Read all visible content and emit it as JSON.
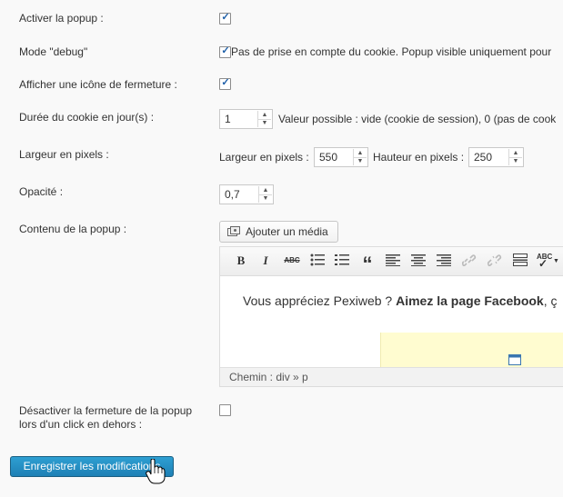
{
  "settings": {
    "activer_popup": {
      "label": "Activer la popup :",
      "checked": true
    },
    "mode_debug": {
      "label": "Mode \"debug\"",
      "checked": true,
      "description": "Pas de prise en compte du cookie. Popup visible uniquement pour"
    },
    "icone_fermeture": {
      "label": "Afficher une icône de fermeture :",
      "checked": true
    },
    "duree_cookie": {
      "label": "Durée du cookie en jour(s) :",
      "value": "1",
      "description": "Valeur possible : vide (cookie de session), 0 (pas de cook"
    },
    "largeur": {
      "label": "Largeur en pixels :",
      "width_label": "Largeur en pixels :",
      "width_value": "550",
      "height_label": "Hauteur en pixels :",
      "height_value": "250"
    },
    "opacite": {
      "label": "Opacité :",
      "value": "0,7"
    },
    "contenu": {
      "label": "Contenu de la popup :",
      "media_button": "Ajouter un média"
    },
    "desactiver_fermeture": {
      "label_line1": "Désactiver la fermeture de la popup",
      "label_line2": "lors d'un click en dehors :",
      "checked": false
    }
  },
  "editor": {
    "toolbar": {
      "bold": "B",
      "italic": "I",
      "strike": "ABC",
      "quote": "“",
      "spell": "ABC"
    },
    "content": {
      "text_start": "Vous appréciez Pexiweb ? ",
      "text_bold": "Aimez la page Facebook",
      "text_end": ", ç"
    },
    "status": "Chemin : div » p"
  },
  "save_button": "Enregistrer les modifications",
  "colors": {
    "primary": "#2e9fd2",
    "checkbox_tick": "#1e5fa8",
    "highlight": "#fffcd0"
  }
}
